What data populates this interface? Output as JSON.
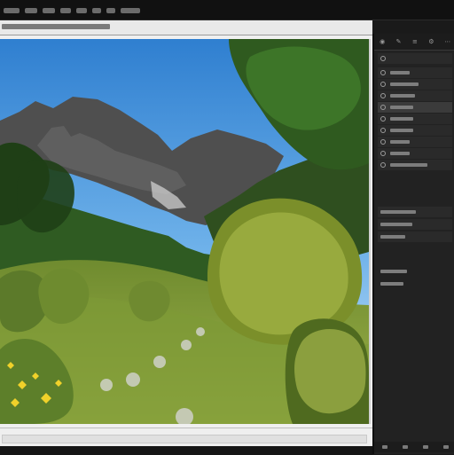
{
  "menu": {
    "items": [
      {
        "label": "",
        "width": 18
      },
      {
        "label": "",
        "width": 14
      },
      {
        "label": "",
        "width": 14
      },
      {
        "label": "",
        "width": 12
      },
      {
        "label": "",
        "width": 12
      },
      {
        "label": "",
        "width": 10
      },
      {
        "label": "",
        "width": 10
      },
      {
        "label": "",
        "width": 22
      }
    ]
  },
  "pathbar": {
    "text": ""
  },
  "canvas": {
    "image_desc": ""
  },
  "panel": {
    "toolbar_icons": [
      "eye-icon",
      "brush-icon",
      "layers-icon",
      "gear-icon",
      "more-icon"
    ],
    "header": {
      "label": ""
    },
    "layers": [
      {
        "label": "",
        "bar": 22
      },
      {
        "label": "",
        "bar": 32
      },
      {
        "label": "",
        "bar": 28
      },
      {
        "label": "",
        "bar": 26,
        "selected": true
      },
      {
        "label": "",
        "bar": 26
      },
      {
        "label": "",
        "bar": 26
      },
      {
        "label": "",
        "bar": 22
      },
      {
        "label": "",
        "bar": 22
      },
      {
        "label": "",
        "bar": 42
      }
    ],
    "section2": [
      {
        "label": "",
        "bar": 40
      },
      {
        "label": "",
        "bar": 36
      },
      {
        "label": "",
        "bar": 28
      }
    ],
    "section3": [
      {
        "label": "",
        "bar": 30
      },
      {
        "label": "",
        "bar": 26
      }
    ]
  },
  "colors": {
    "sky": "#5aa6e6",
    "mountain": "#5b5b5b",
    "grass": "#8aa440",
    "shrub": "#a7b84a",
    "flower": "#f0d12a"
  }
}
